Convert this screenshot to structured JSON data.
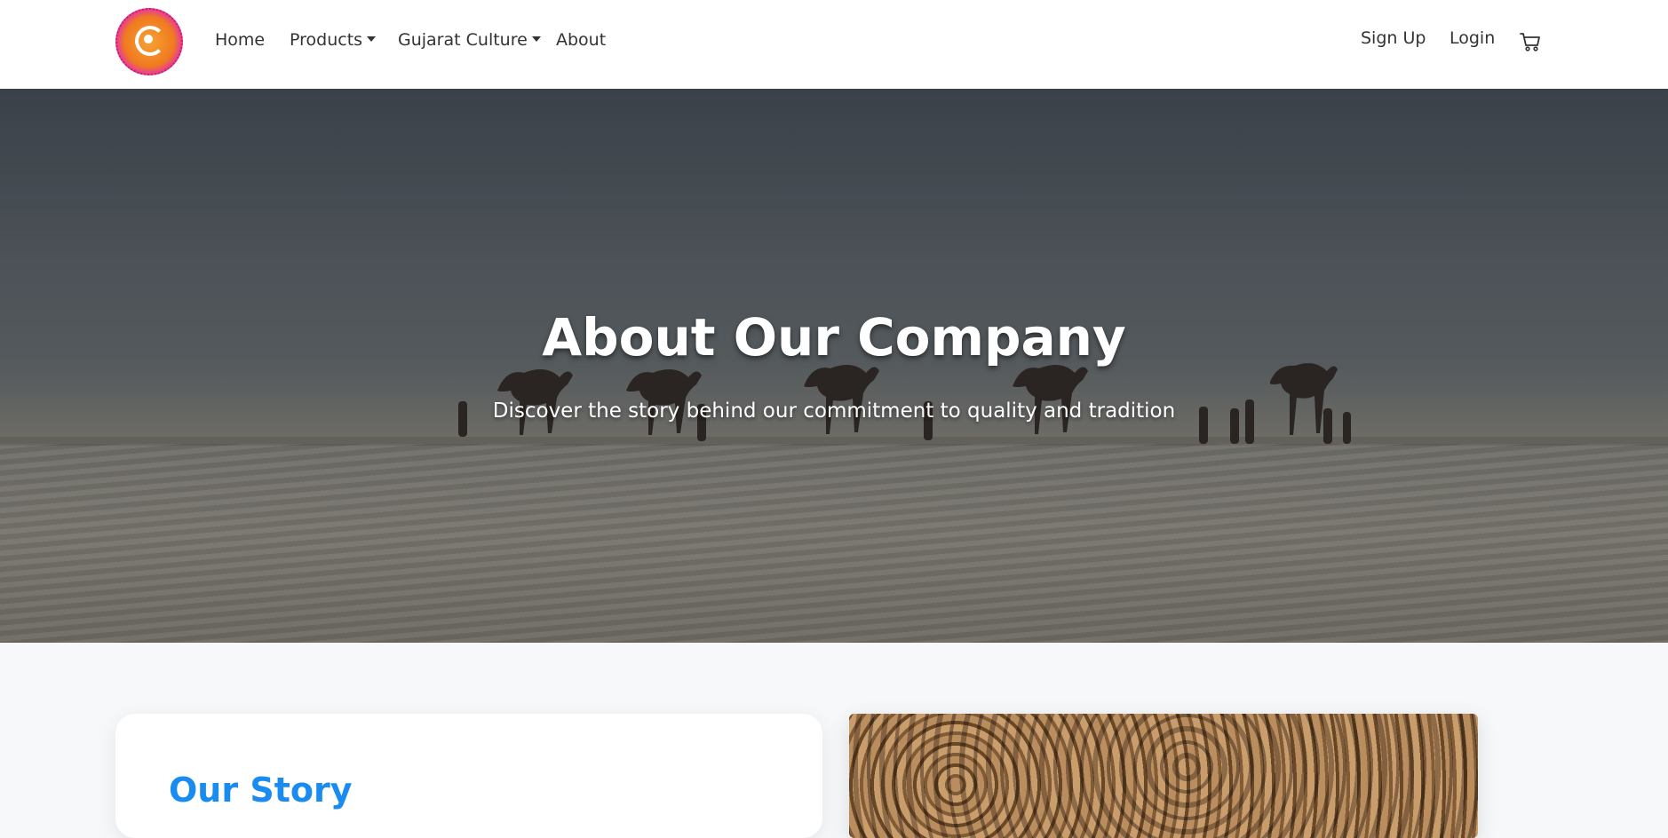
{
  "nav": {
    "logo_icon": "gujarat-logo-icon",
    "links": {
      "home": "Home",
      "products": "Products",
      "culture": "Gujarat Culture",
      "about": "About"
    },
    "signup": "Sign Up",
    "login": "Login",
    "cart_icon": "cart-icon"
  },
  "hero": {
    "title": "About Our Company",
    "subtitle": "Discover the story behind our commitment to quality and tradition"
  },
  "story": {
    "title": "Our Story"
  },
  "colors": {
    "accent": "#1a8cf0",
    "nav_text": "#333333",
    "section_bg": "#f7f8fa"
  }
}
